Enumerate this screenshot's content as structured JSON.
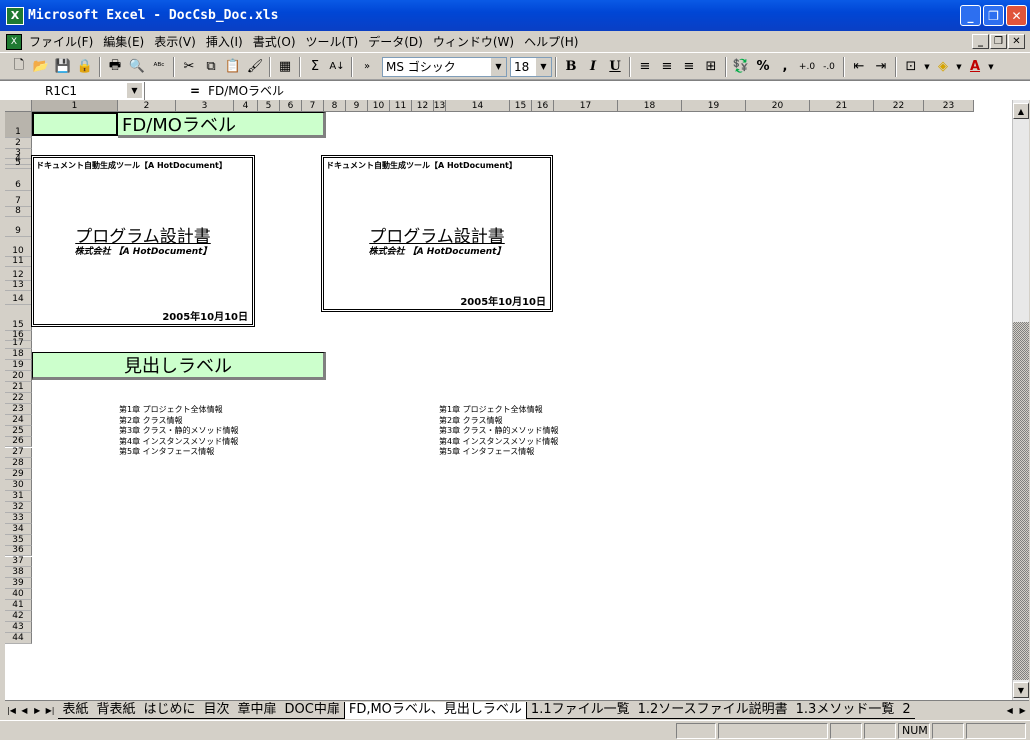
{
  "window": {
    "title": "Microsoft Excel - DocCsb_Doc.xls",
    "app_icon": "X"
  },
  "menu": [
    "ファイル(F)",
    "編集(E)",
    "表示(V)",
    "挿入(I)",
    "書式(O)",
    "ツール(T)",
    "データ(D)",
    "ウィンドウ(W)",
    "ヘルプ(H)"
  ],
  "toolbar": {
    "font": "MS ゴシック",
    "size": "18",
    "bold": "B",
    "italic": "I",
    "underline": "U",
    "percent": "%",
    "comma": ",",
    "sigma": "Σ"
  },
  "formula": {
    "name_box": "R1C1",
    "eq": "=",
    "value": "FD/MOラベル"
  },
  "columns": [
    "1",
    "2",
    "3",
    "4",
    "5",
    "6",
    "7",
    "8",
    "9",
    "10",
    "11",
    "12",
    "13",
    "14",
    "15",
    "16",
    "17",
    "18",
    "19",
    "20",
    "21",
    "22",
    "23"
  ],
  "rows": [
    "1",
    "2",
    "3",
    "4",
    "5",
    "6",
    "7",
    "8",
    "9",
    "10",
    "11",
    "12",
    "13",
    "14",
    "15",
    "16",
    "17",
    "18",
    "19",
    "20",
    "21",
    "22",
    "23",
    "24",
    "25",
    "26",
    "27",
    "28",
    "29",
    "30",
    "31",
    "32",
    "33",
    "34",
    "35",
    "36",
    "37",
    "38",
    "39",
    "40",
    "41",
    "42",
    "43",
    "44"
  ],
  "sheet": {
    "label1": "FD/MOラベル",
    "label2": "見出しラベル",
    "cover": {
      "tool": "ドキュメント自動生成ツール【A HotDocument】",
      "title": "プログラム設計書",
      "company": "株式会社 【A HotDocument】",
      "date": "2005年10月10日"
    },
    "toc": [
      "第1章 プロジェクト全体情報",
      "第2章 クラス情報",
      "第3章 クラス・静的メソッド情報",
      "第4章 インスタンスメソッド情報",
      "第5章 インタフェース情報"
    ]
  },
  "tabs": [
    "表紙",
    "背表紙",
    "はじめに",
    "目次",
    "章中扉",
    "DOC中扉",
    "FD,MOラベル、見出しラベル",
    "1.1ファイル一覧",
    "1.2ソースファイル説明書",
    "1.3メソッド一覧",
    "2"
  ],
  "active_tab": "FD,MOラベル、見出しラベル",
  "status": {
    "num": "NUM"
  }
}
